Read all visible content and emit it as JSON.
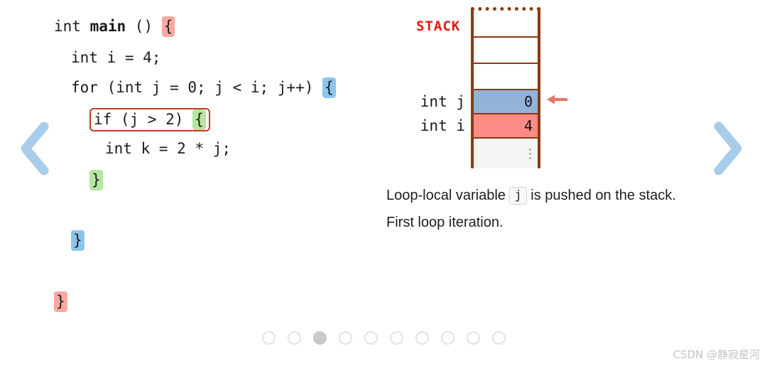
{
  "nav": {
    "prev_icon": "chevron-left-icon",
    "next_icon": "chevron-right-icon",
    "chevron_color": "#a8cdea"
  },
  "code": {
    "language": "c",
    "lines": [
      {
        "indent": 0,
        "text": "int ",
        "bold": "main",
        "tail": " () ",
        "brace": "{",
        "brace_style": "pink"
      },
      {
        "indent": 1,
        "text": "int i = 4;",
        "brace": "",
        "brace_style": ""
      },
      {
        "indent": 1,
        "text": "for (int j = 0; j < i; j++) ",
        "brace": "{",
        "brace_style": "blue"
      },
      {
        "indent": 2,
        "text": "if (j > 2) ",
        "brace": "{",
        "brace_style": "green",
        "boxed": true
      },
      {
        "indent": 3,
        "text": "int k = 2 * j;",
        "brace": "",
        "brace_style": ""
      },
      {
        "indent": 2,
        "text": "",
        "brace": "}",
        "brace_style": "green"
      },
      {
        "indent": 1,
        "text": "",
        "brace": "}",
        "brace_style": "blue"
      },
      {
        "indent": 0,
        "text": "",
        "brace": "}",
        "brace_style": "pink"
      }
    ],
    "line1_prefix": "int ",
    "line1_bold": "main",
    "line1_tail": " () ",
    "line1_brace": "{",
    "line2": "int i = 4;",
    "line3": "for (int j = 0; j < i; j++) ",
    "line3_brace": "{",
    "line4_if": "if (j > 2) ",
    "line4_brace": "{",
    "line5": "int k = 2 * j;",
    "line6_brace": "}",
    "line7_brace": "}",
    "line8_brace": "}",
    "highlight_colors": {
      "pink": "#f9a8a1",
      "blue": "#8cc5ec",
      "green": "#b4e6a0",
      "if_box_border": "#c0392b"
    }
  },
  "stack": {
    "label": "STACK",
    "label_color": "#e01b0e",
    "border_color": "#8b3a12",
    "arrow_icon": "arrow-left-icon",
    "arrow_color": "#e8736a",
    "cells": [
      {
        "label": "",
        "value": "",
        "fill": "#ffffff",
        "height": 38,
        "kind": "empty"
      },
      {
        "label": "",
        "value": "",
        "fill": "#ffffff",
        "height": 37,
        "kind": "empty"
      },
      {
        "label": "",
        "value": "",
        "fill": "#ffffff",
        "height": 37,
        "kind": "empty"
      },
      {
        "label": "int j",
        "value": "0",
        "fill": "#93b4d8",
        "height": 34,
        "kind": "variable"
      },
      {
        "label": "int i",
        "value": "4",
        "fill": "#fa8b86",
        "height": 34,
        "kind": "variable"
      },
      {
        "label": "",
        "value": "",
        "fill": "#f4f4f4",
        "height": 42,
        "kind": "ellipsis"
      }
    ]
  },
  "description": {
    "part1": "Loop-local variable ",
    "chip": "j",
    "part2": " is pushed on the stack.",
    "line2": "First loop iteration."
  },
  "pagination": {
    "total": 10,
    "active_index": 2
  },
  "watermark": {
    "text": "CSDN @静寂星河"
  }
}
